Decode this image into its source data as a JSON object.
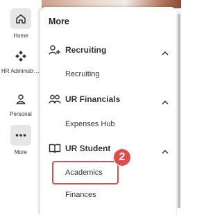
{
  "rail": {
    "items": [
      {
        "label": "Home",
        "icon": "home-icon"
      },
      {
        "label": "HR Administrati...",
        "icon": "hr-admin-icon"
      },
      {
        "label": "Personal",
        "icon": "person-icon"
      },
      {
        "label": "More",
        "icon": "more-dots-icon"
      }
    ]
  },
  "menu": {
    "title": "More",
    "sections": [
      {
        "label": "Recruiting",
        "icon": "person-add-icon",
        "expanded": true,
        "items": [
          "Recruiting"
        ]
      },
      {
        "label": "UR Financials",
        "icon": "people-group-icon",
        "expanded": true,
        "items": [
          "Expenses Hub"
        ]
      },
      {
        "label": "UR Student",
        "icon": "book-icon",
        "expanded": true,
        "items": [
          "Academics",
          "Finances"
        ]
      }
    ]
  },
  "annotation": {
    "badge_number": "2",
    "highlight_color": "#e04b4b"
  }
}
